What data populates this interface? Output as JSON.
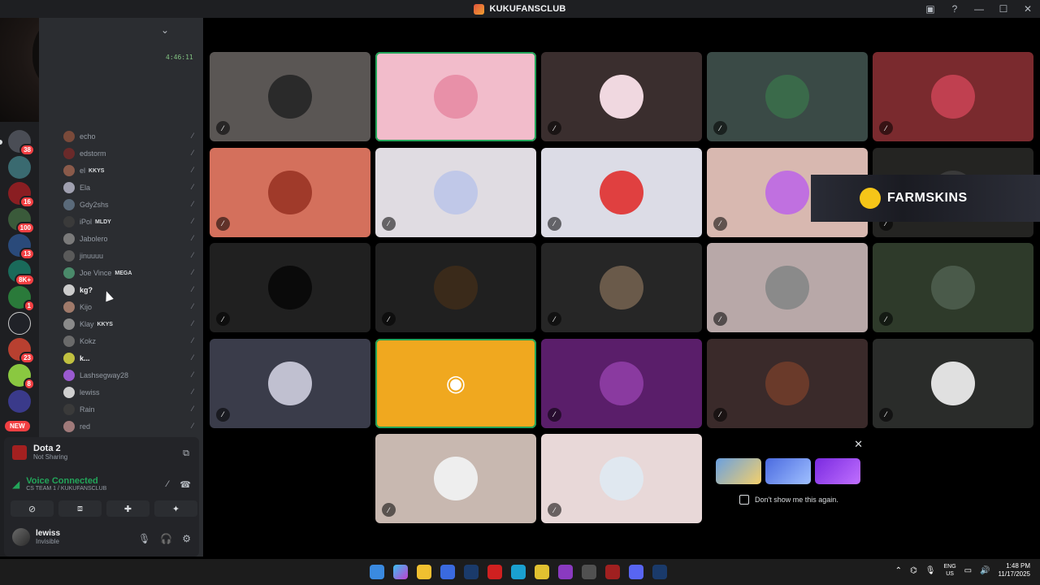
{
  "window": {
    "title": "KUKUFANSCLUB",
    "controls": [
      "inbox",
      "help",
      "minimize",
      "maximize",
      "close"
    ]
  },
  "sidebar": {
    "call_timer": "4:46:11",
    "members": [
      {
        "name": "echo",
        "tag": "",
        "bright": false
      },
      {
        "name": "edstorm",
        "tag": "",
        "bright": false
      },
      {
        "name": "el",
        "tag": "KKYS",
        "bright": false
      },
      {
        "name": "Ela",
        "tag": "",
        "bright": false
      },
      {
        "name": "Gdy2shs",
        "tag": "",
        "bright": false
      },
      {
        "name": "iPol",
        "tag": "MLDY",
        "bright": false
      },
      {
        "name": "Jabolero",
        "tag": "",
        "bright": false
      },
      {
        "name": "jinuuuu",
        "tag": "",
        "bright": false
      },
      {
        "name": "Joe Vince",
        "tag": "MEGA",
        "bright": false
      },
      {
        "name": "kg?",
        "tag": "",
        "bright": true
      },
      {
        "name": "Kijo",
        "tag": "",
        "bright": false
      },
      {
        "name": "Klay",
        "tag": "KKYS",
        "bright": false
      },
      {
        "name": "Kokz",
        "tag": "",
        "bright": false
      },
      {
        "name": "k...",
        "tag": "",
        "bright": true
      },
      {
        "name": "Lashsegway28",
        "tag": "",
        "bright": false
      },
      {
        "name": "lewiss",
        "tag": "",
        "bright": false
      },
      {
        "name": "Rain",
        "tag": "",
        "bright": false
      },
      {
        "name": "red",
        "tag": "",
        "bright": false
      }
    ]
  },
  "rail": {
    "badges": [
      "38",
      "16",
      "100",
      "13",
      "8K+",
      "1",
      "23",
      "8"
    ],
    "new_label": "NEW"
  },
  "activity": {
    "game": "Dota 2",
    "game_status": "Not Sharing"
  },
  "voice": {
    "status": "Voice Connected",
    "channel": "CS TEAM 1 / KUKUFANSCLUB"
  },
  "user": {
    "name": "lewiss",
    "status": "Invisible"
  },
  "banner": {
    "text": "FARMSKINS"
  },
  "promo": {
    "checkbox_label": "Don't show me this again."
  },
  "taskbar": {
    "lang_1": "ENG",
    "lang_2": "US",
    "time": "1:48 PM",
    "date": "11/17/2025"
  },
  "colors": {
    "speaking": "#23a55a",
    "discord_tile": "#f0a81f",
    "background": "#000000"
  }
}
